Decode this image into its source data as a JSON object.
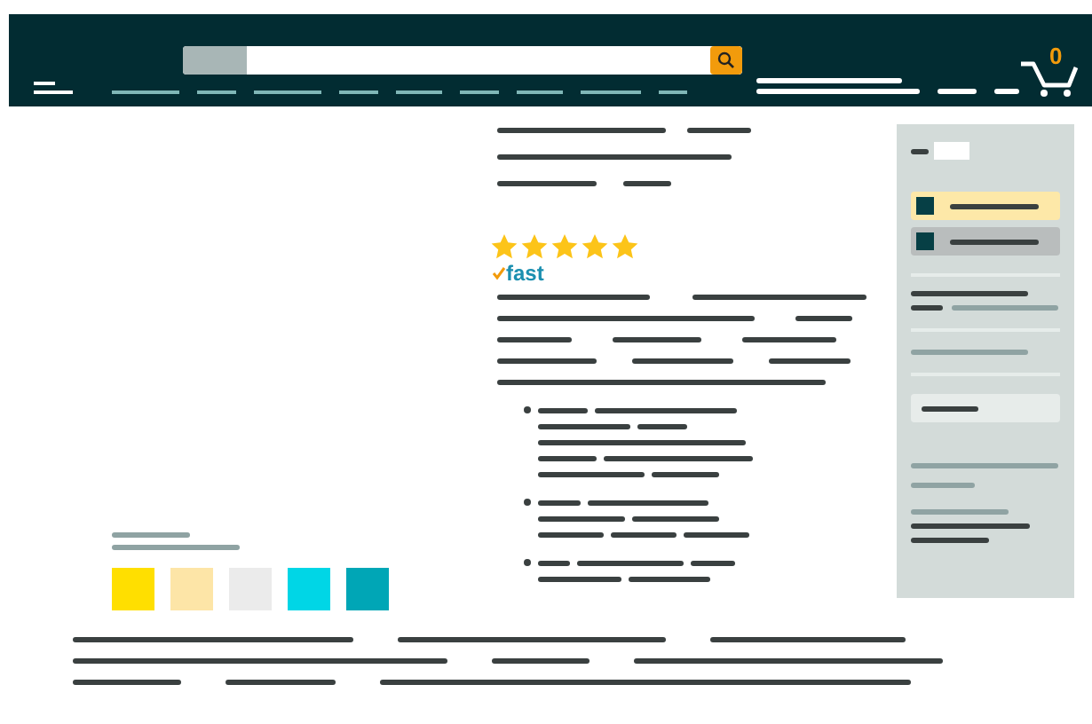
{
  "header": {
    "cart_count": "0"
  },
  "rating": {
    "stars": 5
  },
  "delivery_badge": {
    "label": "fast"
  },
  "swatches": [
    {
      "color": "#ffdf00"
    },
    {
      "color": "#fde5a7"
    },
    {
      "color": "#ebebeb"
    },
    {
      "color": "#00d6e6"
    },
    {
      "color": "#00a6b6"
    }
  ],
  "buy_options": [
    {
      "selected": true
    },
    {
      "selected": false
    }
  ]
}
